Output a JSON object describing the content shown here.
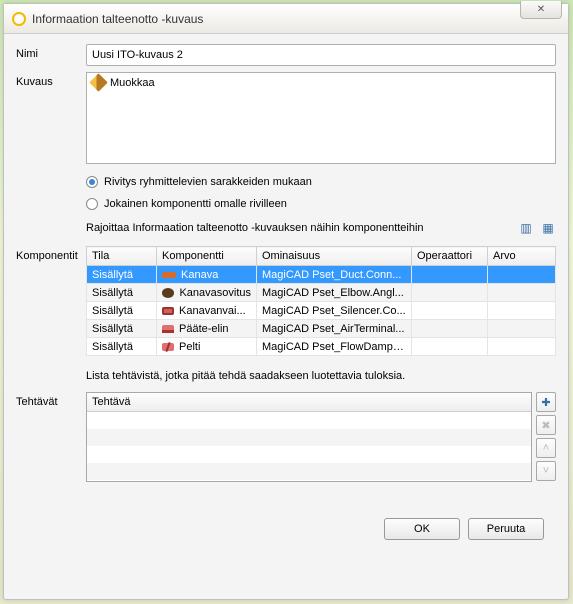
{
  "window": {
    "title": "Informaation talteenotto -kuvaus",
    "close_glyph": "✕"
  },
  "labels": {
    "name": "Nimi",
    "description": "Kuvaus",
    "components": "Komponentit",
    "tasks": "Tehtävät"
  },
  "name_value": "Uusi ITO-kuvaus 2",
  "description": {
    "edit_label": "Muokkaa"
  },
  "wrap_options": {
    "grouped": "Rivitys ryhmittelevien sarakkeiden mukaan",
    "per_row": "Jokainen komponentti omalle rivilleen",
    "selected": "grouped"
  },
  "components": {
    "restrict_text": "Rajoittaa Informaation talteenotto -kuvauksen näihin komponentteihin",
    "headers": {
      "state": "Tila",
      "component": "Komponentti",
      "property": "Ominaisuus",
      "operator": "Operaattori",
      "value": "Arvo"
    },
    "rows": [
      {
        "state": "Sisällytä",
        "icon": "duct",
        "component": "Kanava",
        "property": "MagiCAD Pset_Duct.Conn...",
        "operator": "",
        "value": "",
        "selected": true
      },
      {
        "state": "Sisällytä",
        "icon": "elbow",
        "component": "Kanavasovitus",
        "property": "MagiCAD Pset_Elbow.Angl...",
        "operator": "",
        "value": ""
      },
      {
        "state": "Sisällytä",
        "icon": "silencer",
        "component": "Kanavanvai...",
        "property": "MagiCAD Pset_Silencer.Co...",
        "operator": "",
        "value": ""
      },
      {
        "state": "Sisällytä",
        "icon": "terminal",
        "component": "Pääte-elin",
        "property": "MagiCAD Pset_AirTerminal...",
        "operator": "",
        "value": ""
      },
      {
        "state": "Sisällytä",
        "icon": "damper",
        "component": "Pelti",
        "property": "MagiCAD Pset_FlowDampe...",
        "operator": "",
        "value": ""
      }
    ]
  },
  "tasks": {
    "help_text": "Lista tehtävistä, jotka pitää tehdä saadakseen luotettavia tuloksia.",
    "header": "Tehtävä"
  },
  "buttons": {
    "ok": "OK",
    "cancel": "Peruuta"
  }
}
